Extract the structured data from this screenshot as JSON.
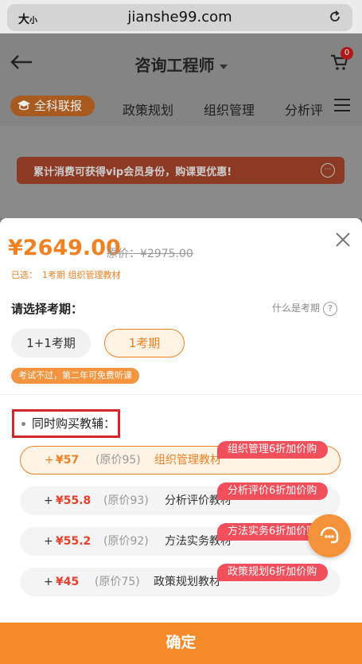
{
  "browser": {
    "size_label_big": "大",
    "size_label_small": "小",
    "url": "jianshe99.com"
  },
  "header": {
    "title": "咨询工程师",
    "cart_count": "0"
  },
  "tabs": {
    "active": "全科联报",
    "items": [
      "政策规划",
      "组织管理",
      "分析评"
    ]
  },
  "promo": {
    "text": "累计消费可获得vip会员身份，购课更优惠!"
  },
  "sheet": {
    "price": "¥2649.00",
    "original_price": "原价：¥2975.00",
    "selected_label": "已选：",
    "selected_value": "1考期  组织管理教材",
    "period_label": "请选择考期：",
    "what_is_period": "什么是考期",
    "period_options": [
      "1+1考期",
      "1考期"
    ],
    "notice": "考试不过，第二年可免费听课",
    "addon_title": "同时购买教辅：",
    "addons": [
      {
        "plus": "+",
        "price": "¥57",
        "orig": "(原价95)",
        "name": "组织管理教材",
        "tag": "组织管理6折加价购"
      },
      {
        "plus": "+",
        "price": "¥55.8",
        "orig": "(原价93)",
        "name": "分析评价教材",
        "tag": "分析评价6折加价购"
      },
      {
        "plus": "+",
        "price": "¥55.2",
        "orig": "(原价92)",
        "name": "方法实务教材",
        "tag": "方法实务6折加价购"
      },
      {
        "plus": "+",
        "price": "¥45",
        "orig": "(原价75)",
        "name": "政策规划教材",
        "tag": "政策规划6折加价购"
      }
    ],
    "confirm": "确定"
  },
  "colors": {
    "accent": "#f08123",
    "price_red": "#e8402b",
    "tag_red": "#f04f5b",
    "highlight_box": "#d4262b"
  }
}
